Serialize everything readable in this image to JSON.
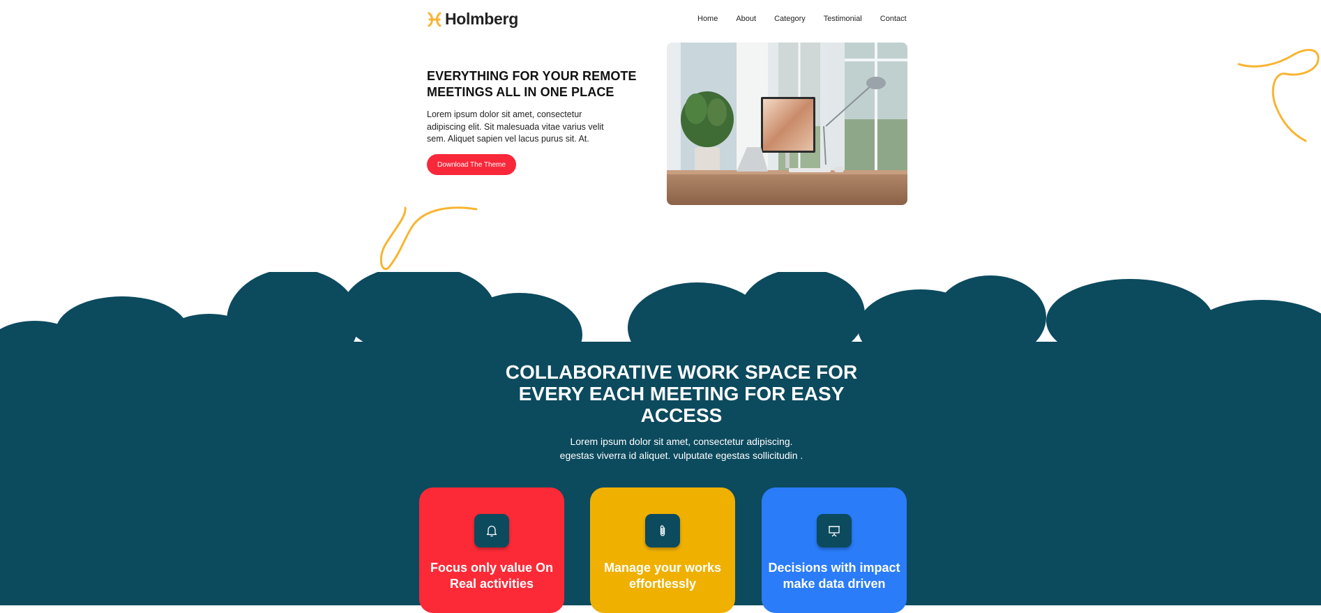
{
  "brand": {
    "name": "Holmberg",
    "logo_icon": "pisces-logo-icon",
    "accent": "#f8b431"
  },
  "nav": {
    "items": [
      "Home",
      "About",
      "Category",
      "Testimonial",
      "Contact"
    ]
  },
  "hero": {
    "title": "EVERYTHING FOR YOUR REMOTE MEETINGS ALL IN ONE PLACE",
    "text": "Lorem ipsum dolor sit amet, consectetur adipiscing elit. Sit malesuada vitae varius velit sem. Aliquet sapien vel lacus purus sit. At.",
    "cta_label": "Download The Theme",
    "cta_color": "#f8283a"
  },
  "section": {
    "title": "COLLABORATIVE WORK SPACE FOR EVERY EACH MEETING FOR EASY ACCESS",
    "text_line1": "Lorem ipsum dolor sit amet, consectetur adipiscing.",
    "text_line2": "egestas viverra id aliquet. vulputate egestas sollicitudin .",
    "background": "#0c4a5e"
  },
  "cards": [
    {
      "title": "Focus only value On Real activities",
      "icon": "bell-icon",
      "color": "#fc2a37"
    },
    {
      "title": "Manage your works effortlessly",
      "icon": "paperclip-icon",
      "color": "#f0b000"
    },
    {
      "title": "Decisions with impact make data driven",
      "icon": "presentation-icon",
      "color": "#2a7cf9"
    }
  ]
}
